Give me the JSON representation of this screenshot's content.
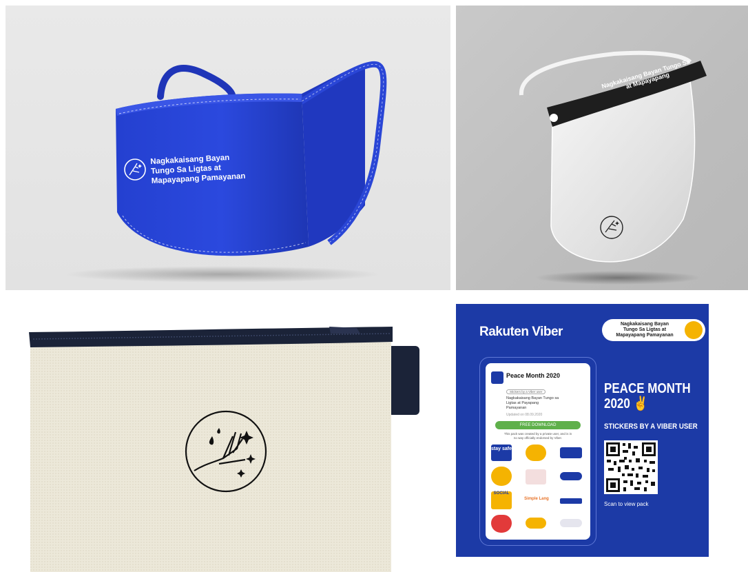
{
  "mask": {
    "print_line1": "Nagkakaisang Bayan",
    "print_line2": "Tungo Sa Ligtas at",
    "print_line3": "Mapayapang Pamayanan",
    "colors": {
      "fabric": "#2a46d6",
      "background": "#e6e6e6"
    }
  },
  "shield": {
    "band_line1": "Nagkakaisang Bayan Tungo Sa",
    "band_line2": "at Mapayapang",
    "colors": {
      "band": "#1e1e1e",
      "background": "#c4c4c4"
    }
  },
  "pouch": {
    "colors": {
      "canvas": "#ece8d9",
      "zipper": "#1b2338"
    }
  },
  "viber": {
    "brand": "Rakuten Viber",
    "badge_line1": "Nagkakaisang Bayan",
    "badge_line2": "Tungo Sa Ligtas at",
    "badge_line3": "Mapayapang Pamayanan",
    "card": {
      "title": "Peace Month 2020",
      "chip": "Stickers by a Viber user",
      "desc_line1": "Nagkakaisang Bayan Tungo sa",
      "desc_line2": "Ligtas at Payapang",
      "desc_line3": "Pamayanan",
      "updated": "Updated on 08.09.2020",
      "download": "FREE DOWNLOAD",
      "disclaimer_line1": "This pack was created by a private user, and is in",
      "disclaimer_line2": "no way officially endorsed by Viber.",
      "sticker_text": [
        "stay safe",
        "SOCIAL",
        "Simple Lang"
      ]
    },
    "heading_line1": "PEACE MONTH",
    "heading_line2": "2020",
    "subheading": "STICKERS BY A VIBER USER",
    "scan": "Scan to view pack",
    "colors": {
      "background": "#1c3aa6",
      "accent": "#f5b301",
      "button": "#5fb04b"
    }
  }
}
